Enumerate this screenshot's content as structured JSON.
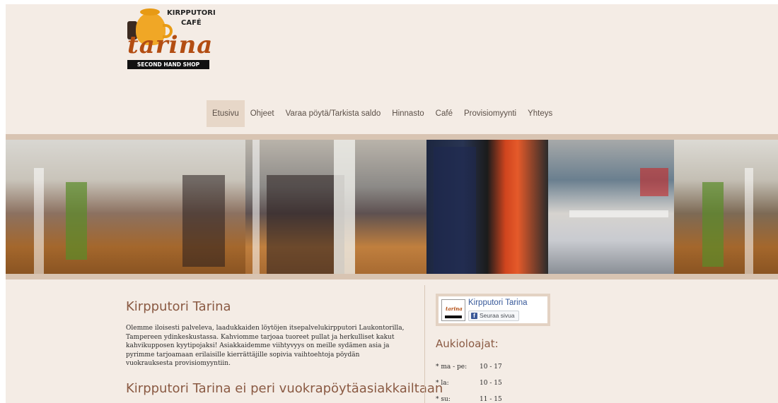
{
  "header": {
    "logo": {
      "line1": "KIRPPUTORI",
      "line2": "CAFÉ",
      "name": "tarina",
      "tagline": "SECOND HAND SHOP"
    }
  },
  "nav": {
    "items": [
      {
        "label": "Etusivu",
        "active": true
      },
      {
        "label": "Ohjeet",
        "active": false
      },
      {
        "label": "Varaa pöytä/Tarkista saldo",
        "active": false
      },
      {
        "label": "Hinnasto",
        "active": false
      },
      {
        "label": "Café",
        "active": false
      },
      {
        "label": "Provisiomyynti",
        "active": false
      },
      {
        "label": "Yhteys",
        "active": false
      }
    ]
  },
  "main": {
    "title": "Kirpputori Tarina",
    "intro": "Olemme iloisesti palveleva, laadukkaiden löytöjen itsepalvelukirpputori Laukontorilla, Tampereen ydinkeskustassa. Kahviomme tarjoaa tuoreet pullat ja herkulliset kakut kahvikupposen kyytipojaksi! Asiakkaidemme viihtyvyys on meille sydämen asia ja pyrimme tarjoamaan erilaisille kierrättäjille sopivia vaihtoehtoja pöydän vuokrauksesta provisiomyyntiin.",
    "subtitle": "Kirpputori Tarina ei peri vuokrapöytäasiakkailtaan"
  },
  "sidebar": {
    "facebook": {
      "page_name": "Kirpputori Tarina",
      "follow_label": "Seuraa sivua"
    },
    "hours_title": "Aukioloajat:",
    "hours": [
      {
        "day": "* ma - pe:",
        "time": "10 - 17"
      },
      {
        "day": "* la:",
        "time": "10 - 15"
      },
      {
        "day": "* su:",
        "time": "11 - 15"
      }
    ]
  },
  "colors": {
    "page_bg": "#f4ece5",
    "accent": "#8a5a43",
    "brand_orange": "#b34d12",
    "nav_active": "#e7d7c8"
  }
}
